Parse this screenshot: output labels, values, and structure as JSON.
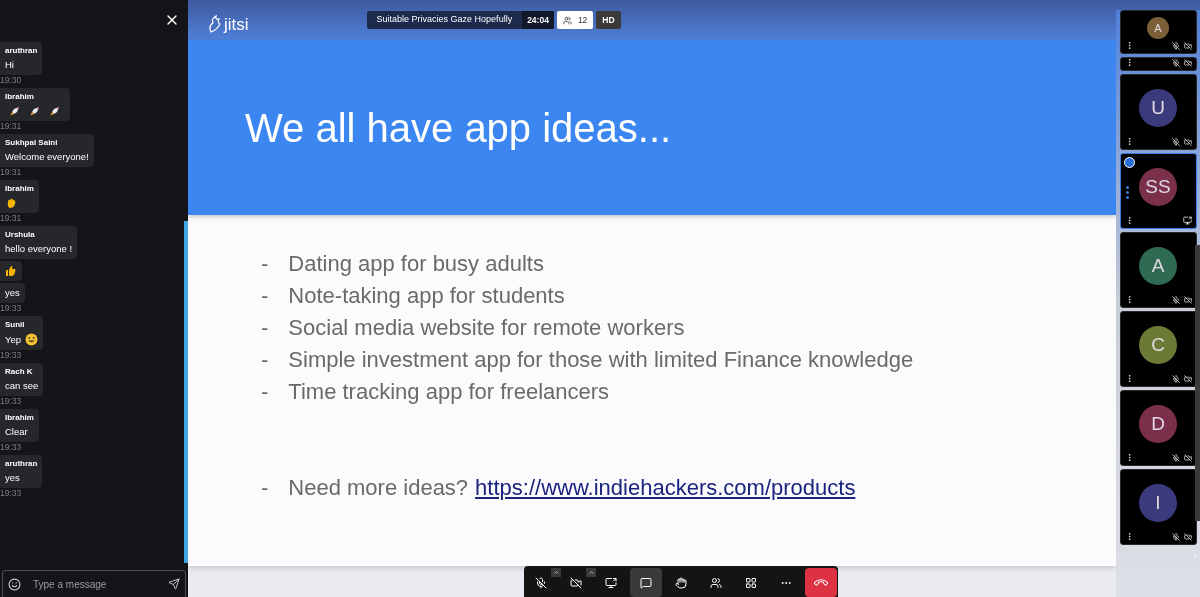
{
  "chat": {
    "messages": [
      {
        "sender": "aruthran",
        "text": "Hi",
        "kind": "plain",
        "time": "19:30"
      },
      {
        "sender": "Ibrahim",
        "kind": "rockets",
        "time": "19:31"
      },
      {
        "sender": "Sukhpal Saini",
        "text": "Welcome everyone!",
        "kind": "plain",
        "time": "19:31"
      },
      {
        "sender": "Ibrahim",
        "kind": "wave",
        "time": "19:31"
      },
      {
        "sender": "Urshula",
        "text": "hello everyone !",
        "kind": "plain"
      },
      {
        "kind": "thumbs-up"
      },
      {
        "text": "yes",
        "kind": "plain",
        "time": "19:33"
      },
      {
        "sender": "Sunil",
        "text": "Yep",
        "kind": "smile",
        "time": "19:33"
      },
      {
        "sender": "Rach K",
        "text": "can see",
        "kind": "plain",
        "time": "19:33"
      },
      {
        "sender": "Ibrahim",
        "text": "Clear",
        "kind": "plain",
        "time": "19:33"
      },
      {
        "sender": "aruthran",
        "text": "yes",
        "kind": "plain",
        "time": "19:33"
      }
    ],
    "input": {
      "placeholder": "Type a message"
    }
  },
  "header": {
    "logo": "jitsi",
    "meeting_title": "Suitable Privacies Gaze Hopefully",
    "timer": "24:04",
    "participant_count": "12",
    "quality": "HD"
  },
  "slide": {
    "title": "We all have app ideas...",
    "bullets": [
      {
        "marker": "-",
        "text": "Dating app for busy adults"
      },
      {
        "marker": "-",
        "text": "Note-taking app for students"
      },
      {
        "marker": "-",
        "text": "Social media website for remote workers"
      },
      {
        "marker": "-",
        "text": "Simple investment app for those with limited Finance knowledge"
      },
      {
        "marker": "-",
        "text": "Time tracking app for freelancers"
      }
    ],
    "footer": {
      "marker": "-",
      "text": "Need more ideas?",
      "link": "https://www.indiehackers.com/products"
    }
  },
  "filmstrip": [
    {
      "kind": "tile",
      "initials": "A",
      "color": "#7a5f37",
      "muted": true,
      "camera_off": true,
      "sharing": false,
      "active": false,
      "speaking": false
    },
    {
      "kind": "strip",
      "muted": true,
      "camera_off": true,
      "sharing": false,
      "active": false,
      "speaking": false
    },
    {
      "kind": "tile",
      "initials": "U",
      "color": "#3b3a7c",
      "muted": true,
      "camera_off": true,
      "sharing": false,
      "active": false,
      "speaking": false
    },
    {
      "kind": "tile",
      "initials": "SS",
      "color": "#7a2f4a",
      "muted": false,
      "camera_off": false,
      "sharing": true,
      "active": true,
      "speaking": true
    },
    {
      "kind": "tile",
      "initials": "A",
      "color": "#2f6b52",
      "muted": true,
      "camera_off": true,
      "sharing": false,
      "active": false,
      "speaking": false
    },
    {
      "kind": "tile",
      "initials": "C",
      "color": "#6b7a35",
      "muted": true,
      "camera_off": true,
      "sharing": false,
      "active": false,
      "speaking": false
    },
    {
      "kind": "tile",
      "initials": "D",
      "color": "#7a2f4a",
      "muted": true,
      "camera_off": true,
      "sharing": false,
      "active": false,
      "speaking": false
    },
    {
      "kind": "tile",
      "initials": "I",
      "color": "#3b3a7c",
      "muted": true,
      "camera_off": true,
      "sharing": false,
      "active": false,
      "speaking": false
    }
  ],
  "toolbar": [
    {
      "kind": "mic",
      "selected": false,
      "menu": true
    },
    {
      "kind": "camera",
      "selected": false,
      "menu": true
    },
    {
      "kind": "share",
      "selected": false,
      "menu": false
    },
    {
      "kind": "chat",
      "selected": true,
      "menu": false
    },
    {
      "kind": "hand",
      "selected": false,
      "menu": false
    },
    {
      "kind": "participants",
      "selected": false,
      "menu": false
    },
    {
      "kind": "tiles",
      "selected": false,
      "menu": false
    },
    {
      "kind": "more",
      "selected": false,
      "menu": false
    },
    {
      "kind": "hangup",
      "selected": false,
      "menu": false
    }
  ]
}
